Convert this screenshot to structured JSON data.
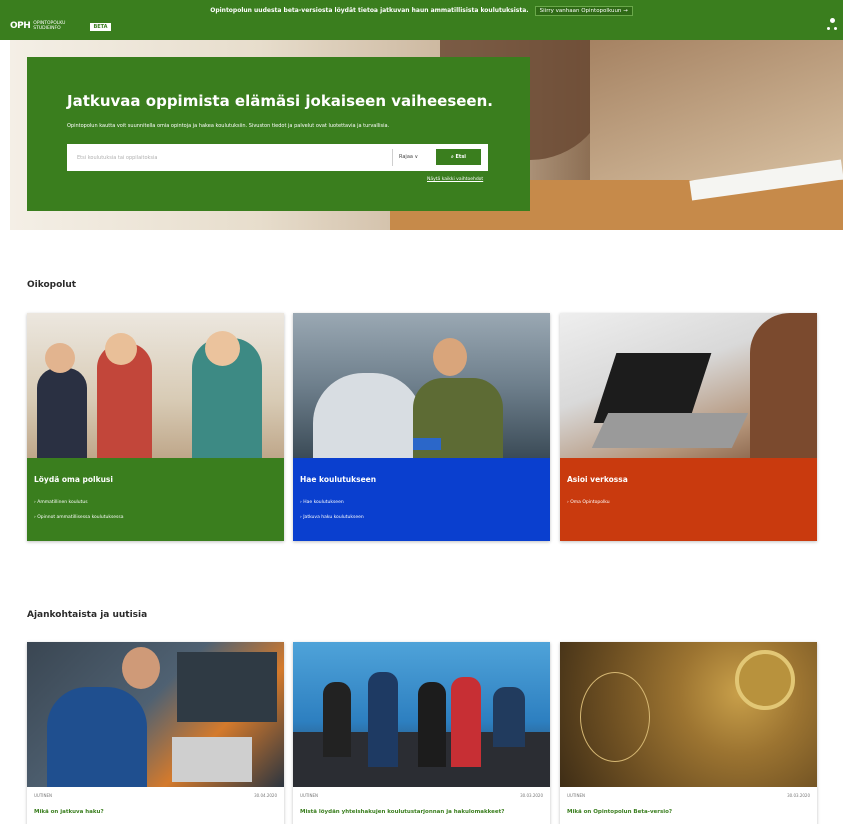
{
  "banner": {
    "notice": "Opintopolun uudesta beta-versiosta löydät tietoa jatkuvan haun ammatillisista koulutuksista.",
    "notice_link": "Siirry vanhaan Opintopolkuun →"
  },
  "header": {
    "logo_mark": "OPH",
    "logo_line1": "OPINTOPOLKU",
    "logo_line2": "STUDIEINFO",
    "beta": "BETA"
  },
  "hero": {
    "title": "Jatkuvaa oppimista elämäsi jokaiseen vaiheeseen.",
    "subtitle": "Opintopolun kautta voit suunnitella omia opintoja ja hakea koulutuksiin. Sivuston tiedot ja palvelut ovat luotettavia ja turvallisia.",
    "search_placeholder": "Etsi koulutuksia tai oppilaitoksia",
    "search_scope": "Rajaa ∨",
    "search_button": "Etsi",
    "more_options": "Näytä kaikki vaihtoehdot"
  },
  "shortcuts": {
    "title": "Oikopolut",
    "cards": [
      {
        "title": "Löydä oma polkusi",
        "color": "#3a7e1e",
        "links": [
          "Ammatillinen koulutus",
          "Opinnot ammatillisessa koulutuksessa"
        ]
      },
      {
        "title": "Hae koulutukseen",
        "color": "#0a3fcf",
        "links": [
          "Hae koulutukseen",
          "Jatkuva haku koulutukseen"
        ]
      },
      {
        "title": "Asioi verkossa",
        "color": "#c93a0e",
        "links": [
          "Oma Opintopolku"
        ]
      }
    ]
  },
  "news": {
    "title": "Ajankohtaista ja uutisia",
    "items": [
      {
        "category": "UUTINEN",
        "date": "30.04.2020",
        "title": "Mikä on jatkuva haku?"
      },
      {
        "category": "UUTINEN",
        "date": "30.03.2020",
        "title": "Mistä löydän yhteishakujen koulutustarjonnan ja hakulomakkeet?"
      },
      {
        "category": "UUTINEN",
        "date": "30.03.2020",
        "title": "Mikä on Opintopolun Beta-versio?"
      }
    ]
  }
}
